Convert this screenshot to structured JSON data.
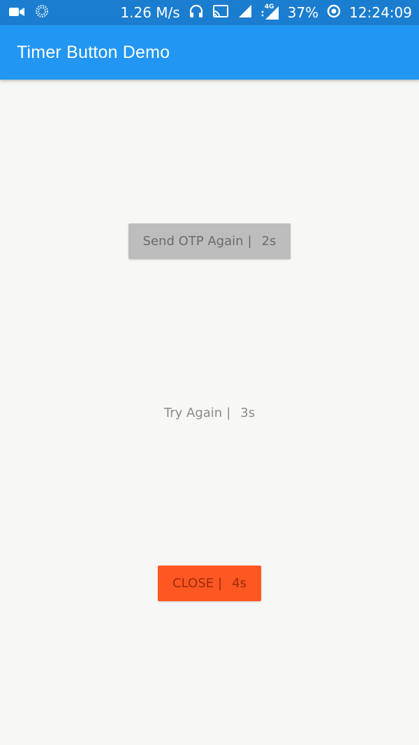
{
  "status_bar": {
    "network_speed": "1.26 M/s",
    "network_type": "4G",
    "battery": "37%",
    "time": "12:24:09",
    "icons": [
      "video-camera-icon",
      "loading-icon",
      "headphones-icon",
      "cast-icon",
      "signal-icon",
      "signal-4g-icon",
      "battery-ring-icon"
    ]
  },
  "app_bar": {
    "title": "Timer Button Demo",
    "color": "#2196f3"
  },
  "buttons": [
    {
      "label": "Send OTP Again",
      "separator": "|",
      "countdown": "2s",
      "style": "raised-disabled",
      "color": "#bdbdbd"
    },
    {
      "label": "Try Again",
      "separator": "|",
      "countdown": "3s",
      "style": "flat-disabled",
      "color": "transparent"
    },
    {
      "label": "CLOSE",
      "separator": "|",
      "countdown": "4s",
      "style": "raised-accent",
      "color": "#ff5722"
    }
  ]
}
